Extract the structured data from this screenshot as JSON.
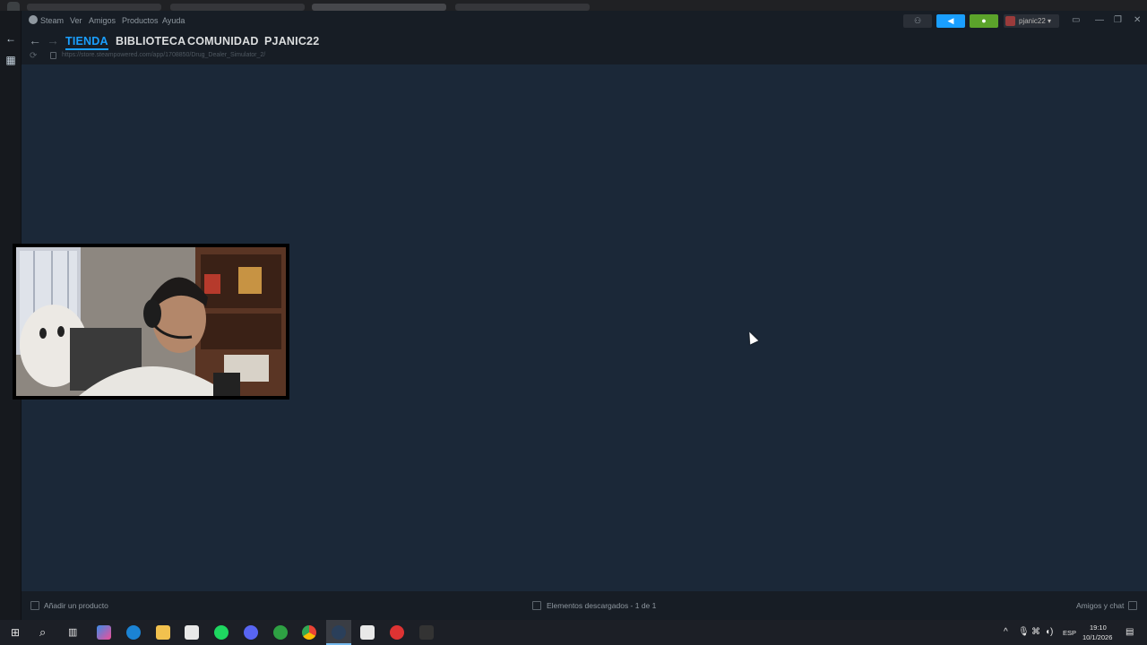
{
  "menu": {
    "steam": "Steam",
    "ver": "Ver",
    "amigos": "Amigos",
    "productos": "Productos",
    "ayuda": "Ayuda"
  },
  "user": {
    "name": "pjanic22 ▾"
  },
  "nav": {
    "tabs": [
      "TIENDA",
      "BIBLIOTECA",
      "COMUNIDAD",
      "PJANIC22"
    ],
    "active": "TIENDA"
  },
  "url": "https://store.steampowered.com/app/1708850/Drug_Dealer_Simulator_2/",
  "bottom": {
    "add_product": "Añadir un producto",
    "downloads": "Elementos descargados - 1 de 1",
    "friends": "Amigos y chat"
  },
  "taskbar": {
    "lang": "ESP",
    "time": "19:10",
    "date": "10/1/2026"
  },
  "colors": {
    "accent": "#1a9fff",
    "content_bg": "#1b2838",
    "notification_green": "#5ba32b",
    "announce_blue": "#1a9fff"
  },
  "icons": [
    "steam-icon",
    "back-arrow-icon",
    "forward-arrow-icon",
    "reload-icon",
    "lock-icon",
    "friends-icon",
    "megaphone-icon",
    "bell-icon",
    "minimize-icon",
    "maximize-icon",
    "close-icon",
    "windows-start-icon",
    "search-icon",
    "task-view-icon"
  ]
}
